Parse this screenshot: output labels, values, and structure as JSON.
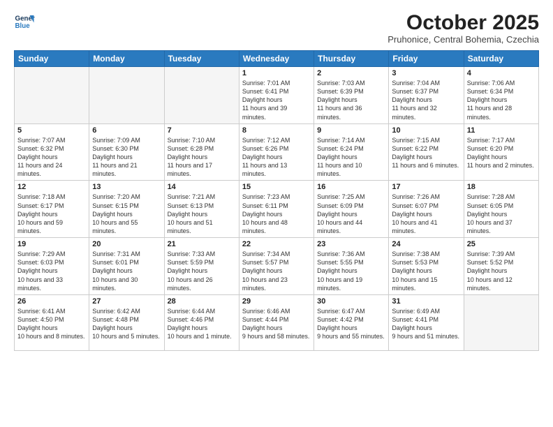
{
  "header": {
    "logo_line1": "General",
    "logo_line2": "Blue",
    "month_title": "October 2025",
    "location": "Pruhonice, Central Bohemia, Czechia"
  },
  "weekdays": [
    "Sunday",
    "Monday",
    "Tuesday",
    "Wednesday",
    "Thursday",
    "Friday",
    "Saturday"
  ],
  "weeks": [
    [
      {
        "day": "",
        "empty": true
      },
      {
        "day": "",
        "empty": true
      },
      {
        "day": "",
        "empty": true
      },
      {
        "day": "1",
        "sunrise": "7:01 AM",
        "sunset": "6:41 PM",
        "daylight": "11 hours and 39 minutes."
      },
      {
        "day": "2",
        "sunrise": "7:03 AM",
        "sunset": "6:39 PM",
        "daylight": "11 hours and 36 minutes."
      },
      {
        "day": "3",
        "sunrise": "7:04 AM",
        "sunset": "6:37 PM",
        "daylight": "11 hours and 32 minutes."
      },
      {
        "day": "4",
        "sunrise": "7:06 AM",
        "sunset": "6:34 PM",
        "daylight": "11 hours and 28 minutes."
      }
    ],
    [
      {
        "day": "5",
        "sunrise": "7:07 AM",
        "sunset": "6:32 PM",
        "daylight": "11 hours and 24 minutes."
      },
      {
        "day": "6",
        "sunrise": "7:09 AM",
        "sunset": "6:30 PM",
        "daylight": "11 hours and 21 minutes."
      },
      {
        "day": "7",
        "sunrise": "7:10 AM",
        "sunset": "6:28 PM",
        "daylight": "11 hours and 17 minutes."
      },
      {
        "day": "8",
        "sunrise": "7:12 AM",
        "sunset": "6:26 PM",
        "daylight": "11 hours and 13 minutes."
      },
      {
        "day": "9",
        "sunrise": "7:14 AM",
        "sunset": "6:24 PM",
        "daylight": "11 hours and 10 minutes."
      },
      {
        "day": "10",
        "sunrise": "7:15 AM",
        "sunset": "6:22 PM",
        "daylight": "11 hours and 6 minutes."
      },
      {
        "day": "11",
        "sunrise": "7:17 AM",
        "sunset": "6:20 PM",
        "daylight": "11 hours and 2 minutes."
      }
    ],
    [
      {
        "day": "12",
        "sunrise": "7:18 AM",
        "sunset": "6:17 PM",
        "daylight": "10 hours and 59 minutes."
      },
      {
        "day": "13",
        "sunrise": "7:20 AM",
        "sunset": "6:15 PM",
        "daylight": "10 hours and 55 minutes."
      },
      {
        "day": "14",
        "sunrise": "7:21 AM",
        "sunset": "6:13 PM",
        "daylight": "10 hours and 51 minutes."
      },
      {
        "day": "15",
        "sunrise": "7:23 AM",
        "sunset": "6:11 PM",
        "daylight": "10 hours and 48 minutes."
      },
      {
        "day": "16",
        "sunrise": "7:25 AM",
        "sunset": "6:09 PM",
        "daylight": "10 hours and 44 minutes."
      },
      {
        "day": "17",
        "sunrise": "7:26 AM",
        "sunset": "6:07 PM",
        "daylight": "10 hours and 41 minutes."
      },
      {
        "day": "18",
        "sunrise": "7:28 AM",
        "sunset": "6:05 PM",
        "daylight": "10 hours and 37 minutes."
      }
    ],
    [
      {
        "day": "19",
        "sunrise": "7:29 AM",
        "sunset": "6:03 PM",
        "daylight": "10 hours and 33 minutes."
      },
      {
        "day": "20",
        "sunrise": "7:31 AM",
        "sunset": "6:01 PM",
        "daylight": "10 hours and 30 minutes."
      },
      {
        "day": "21",
        "sunrise": "7:33 AM",
        "sunset": "5:59 PM",
        "daylight": "10 hours and 26 minutes."
      },
      {
        "day": "22",
        "sunrise": "7:34 AM",
        "sunset": "5:57 PM",
        "daylight": "10 hours and 23 minutes."
      },
      {
        "day": "23",
        "sunrise": "7:36 AM",
        "sunset": "5:55 PM",
        "daylight": "10 hours and 19 minutes."
      },
      {
        "day": "24",
        "sunrise": "7:38 AM",
        "sunset": "5:53 PM",
        "daylight": "10 hours and 15 minutes."
      },
      {
        "day": "25",
        "sunrise": "7:39 AM",
        "sunset": "5:52 PM",
        "daylight": "10 hours and 12 minutes."
      }
    ],
    [
      {
        "day": "26",
        "sunrise": "6:41 AM",
        "sunset": "4:50 PM",
        "daylight": "10 hours and 8 minutes."
      },
      {
        "day": "27",
        "sunrise": "6:42 AM",
        "sunset": "4:48 PM",
        "daylight": "10 hours and 5 minutes."
      },
      {
        "day": "28",
        "sunrise": "6:44 AM",
        "sunset": "4:46 PM",
        "daylight": "10 hours and 1 minute."
      },
      {
        "day": "29",
        "sunrise": "6:46 AM",
        "sunset": "4:44 PM",
        "daylight": "9 hours and 58 minutes."
      },
      {
        "day": "30",
        "sunrise": "6:47 AM",
        "sunset": "4:42 PM",
        "daylight": "9 hours and 55 minutes."
      },
      {
        "day": "31",
        "sunrise": "6:49 AM",
        "sunset": "4:41 PM",
        "daylight": "9 hours and 51 minutes."
      },
      {
        "day": "",
        "empty": true
      }
    ]
  ]
}
